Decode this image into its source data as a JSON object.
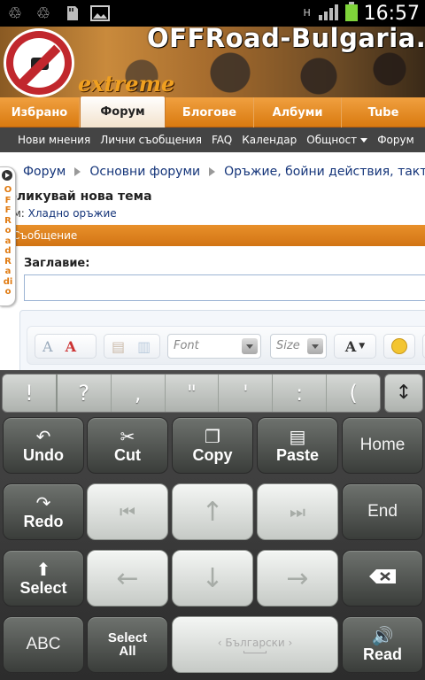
{
  "status": {
    "time": "16:57",
    "icons": [
      "recycle-icon",
      "recycle-icon",
      "sd-card-icon",
      "image-icon"
    ],
    "network": "H"
  },
  "banner": {
    "site_title": "OFFRoad-Bulgaria.",
    "tagline": "extreme"
  },
  "tabs": [
    {
      "label": "Избрано"
    },
    {
      "label": "Форум"
    },
    {
      "label": "Блогове"
    },
    {
      "label": "Албуми"
    },
    {
      "label": "Tube"
    }
  ],
  "subnav": {
    "items": [
      "Нови мнения",
      "Лични съобщения",
      "FAQ",
      "Календар",
      "Общност",
      "Форум"
    ]
  },
  "radio": {
    "label": "OFFRoad Radio"
  },
  "breadcrumb": [
    "Форум",
    "Основни форуми",
    "Оръжие, бойни действия, такт"
  ],
  "page": {
    "heading": "убликувай нова тема",
    "forum_prefix": "рум:",
    "forum_link": "Хладно оръжие",
    "message_bar": "Съобщение",
    "title_label": "Заглавие:",
    "title_value": ""
  },
  "editor": {
    "font_placeholder": "Font",
    "size_placeholder": "Size"
  },
  "keyboard": {
    "punctuation": [
      "!",
      "?",
      ",",
      "\"",
      "'",
      ":",
      "("
    ],
    "undo": "Undo",
    "cut": "Cut",
    "copy": "Copy",
    "paste": "Paste",
    "home": "Home",
    "redo": "Redo",
    "end": "End",
    "select": "Select",
    "abc": "ABC",
    "select_all_1": "Select",
    "select_all_2": "All",
    "language": "Български",
    "read": "Read"
  }
}
